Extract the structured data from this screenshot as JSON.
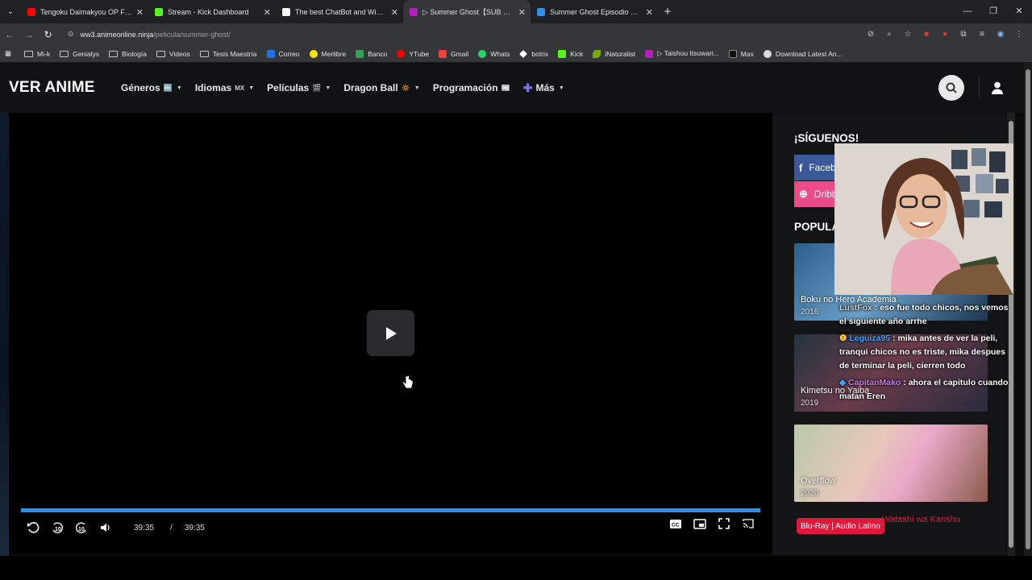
{
  "browser": {
    "tabs": [
      {
        "title": "Tengoku Daimakyou OP Full //",
        "color": "#ff0000"
      },
      {
        "title": "Stream - Kick Dashboard",
        "color": "#53fc18"
      },
      {
        "title": "The best ChatBot and Widgets",
        "color": "#ffffff"
      },
      {
        "title": "▷ Summer Ghost【SUB ESPAÑOL",
        "color": "#b21fbf"
      },
      {
        "title": "Summer Ghost Episodio 1 Sub",
        "color": "#2c90e8"
      }
    ],
    "url_host": "ww3.animeonline.ninja",
    "url_path": "/pelicula/summer-ghost/",
    "bookmarks": [
      {
        "label": "Mi-k",
        "type": "folder"
      },
      {
        "label": "Genialys",
        "type": "folder"
      },
      {
        "label": "Biología",
        "type": "folder"
      },
      {
        "label": "Videos",
        "type": "folder"
      },
      {
        "label": "Tesis Maestría",
        "type": "folder"
      },
      {
        "label": "Correo",
        "type": "site",
        "color": "#1a73e8"
      },
      {
        "label": "Merlibre",
        "type": "site",
        "color": "#ffe600"
      },
      {
        "label": "Banco",
        "type": "site",
        "color": "#2ea44f"
      },
      {
        "label": "YTube",
        "type": "site",
        "color": "#ff0000"
      },
      {
        "label": "Gmail",
        "type": "site",
        "color": "#ea4335"
      },
      {
        "label": "Whats",
        "type": "site",
        "color": "#25d366"
      },
      {
        "label": "botrix",
        "type": "site",
        "color": "#ffffff"
      },
      {
        "label": "Kick",
        "type": "site",
        "color": "#53fc18"
      },
      {
        "label": "iNaturalist",
        "type": "site",
        "color": "#74ac00"
      },
      {
        "label": "▷ Taishou Itsuwari...",
        "type": "site",
        "color": "#b21fbf"
      },
      {
        "label": "Max",
        "type": "site",
        "color": "#101010"
      },
      {
        "label": "Download Latest An...",
        "type": "site",
        "color": "#d9d9d9"
      }
    ]
  },
  "site": {
    "logo": "VER ANIME",
    "menu": [
      {
        "label": "Géneros",
        "badge": "🔤"
      },
      {
        "label": "Idiomas",
        "badge": "MX"
      },
      {
        "label": "Películas",
        "badge": "🎬"
      },
      {
        "label": "Dragon Ball",
        "badge": "🔅"
      },
      {
        "label": "Programación",
        "badge": "📰"
      },
      {
        "label": "Más",
        "badge": ""
      }
    ]
  },
  "player": {
    "current_time": "39:35",
    "separator": "/",
    "duration": "39:35",
    "progress": 1.0,
    "progress_color": "#2c90e8"
  },
  "sidebar": {
    "follow_title": "¡SÍGUENOS!",
    "social": [
      {
        "label": "Facebook",
        "icon": "f",
        "color": "#3b5998"
      },
      {
        "label": "Dribbble",
        "icon": "⊕",
        "color": "#ea4c89"
      }
    ],
    "popular_title": "POPULARES",
    "cards": [
      {
        "title": "Boku no Hero Academia",
        "year": "2016"
      },
      {
        "title": "Kimetsu no Yaiba",
        "year": "2019"
      },
      {
        "title": "Overflow",
        "year": "2020"
      }
    ],
    "tag": "Blu-Ray | Audio Latino",
    "next_title": "Watashi wa Kanshu"
  },
  "chat": [
    {
      "user": "LustFox",
      "message": "eso fue todo chicos, nos vemos el siguiente año arrhe"
    },
    {
      "user": "Leguiza95",
      "message": "mika antes de ver la peli, tranqui chicos no es triste, mika despues de terminar la peli, cierren todo"
    },
    {
      "user": "CapitanMako",
      "message": "ahora el capitulo cuando matan Eren"
    }
  ]
}
